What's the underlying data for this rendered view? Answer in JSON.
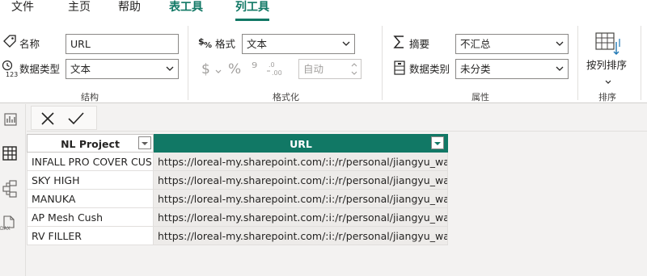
{
  "tabs": [
    "文件",
    "主页",
    "帮助",
    "表工具",
    "列工具"
  ],
  "active_tab": "列工具",
  "structure": {
    "name_label": "名称",
    "name_value": "URL",
    "datatype_label": "数据类型",
    "datatype_value": "文本",
    "group_label": "结构"
  },
  "formatting": {
    "format_label": "格式",
    "format_value": "文本",
    "auto_value": "自动",
    "currency_symbol": "$",
    "percent_symbol": "%",
    "comma_symbol": "⁹",
    "group_label": "格式化"
  },
  "properties": {
    "summary_label": "摘要",
    "summary_value": "不汇总",
    "category_label": "数据类别",
    "category_value": "未分类",
    "group_label": "属性"
  },
  "sort": {
    "button_label": "按列排序",
    "group_label": "排序"
  },
  "table": {
    "columns": [
      "NL Project",
      "URL"
    ],
    "rows": [
      [
        "INFALL PRO COVER CUSH",
        "https://loreal-my.sharepoint.com/:i:/r/personal/jiangyu_wang_l"
      ],
      [
        "SKY HIGH",
        "https://loreal-my.sharepoint.com/:i:/r/personal/jiangyu_wang_l"
      ],
      [
        "MANUKA",
        "https://loreal-my.sharepoint.com/:i:/r/personal/jiangyu_wang_l"
      ],
      [
        "AP Mesh Cush",
        "https://loreal-my.sharepoint.com/:i:/r/personal/jiangyu_wang_l"
      ],
      [
        "RV FILLER",
        "https://loreal-my.sharepoint.com/:i:/r/personal/jiangyu_wang_l"
      ]
    ]
  },
  "nav_icons": [
    "report-view-icon",
    "table-view-icon",
    "model-view-icon",
    "dax-query-view-icon"
  ],
  "nav_dax_label": "DAX",
  "colors": {
    "accent": "#117865",
    "selected_header": "#117865"
  }
}
